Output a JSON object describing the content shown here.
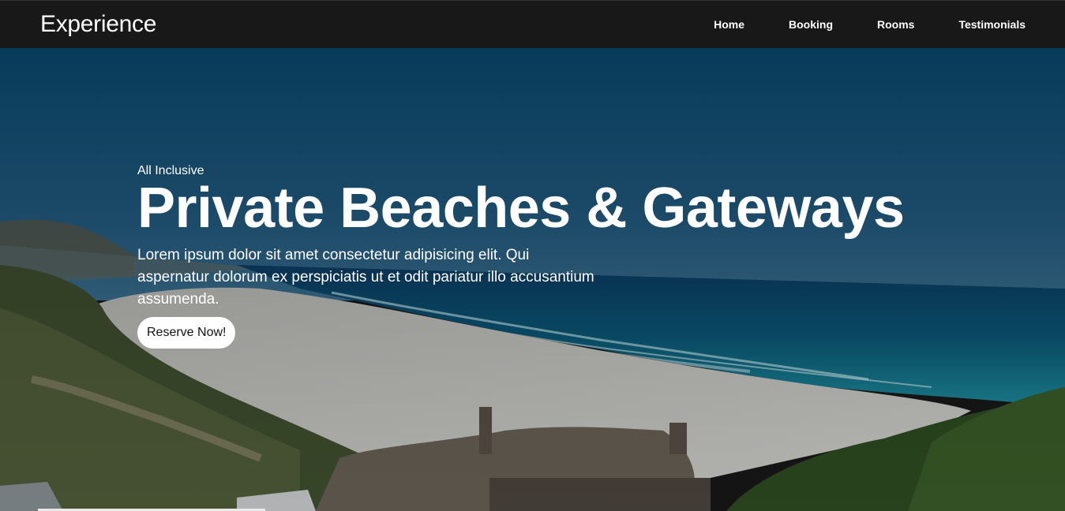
{
  "nav": {
    "brand": "Experience",
    "links": [
      "Home",
      "Booking",
      "Rooms",
      "Testimonials"
    ]
  },
  "hero": {
    "eyebrow": "All Inclusive",
    "headline": "Private Beaches & Gateways",
    "lead": "Lorem ipsum dolor sit amet consectetur adipisicing elit. Qui aspernatur dolorum ex perspiciatis ut et odit pariatur illo accusantium assumenda.",
    "cta_label": "Reserve Now!"
  },
  "colors": {
    "nav_bg": "#181818",
    "sky": "#0c5680",
    "ocean": "#0a5c7e",
    "sand": "#cfcfcb",
    "vegetation": "#3b4a2b"
  }
}
